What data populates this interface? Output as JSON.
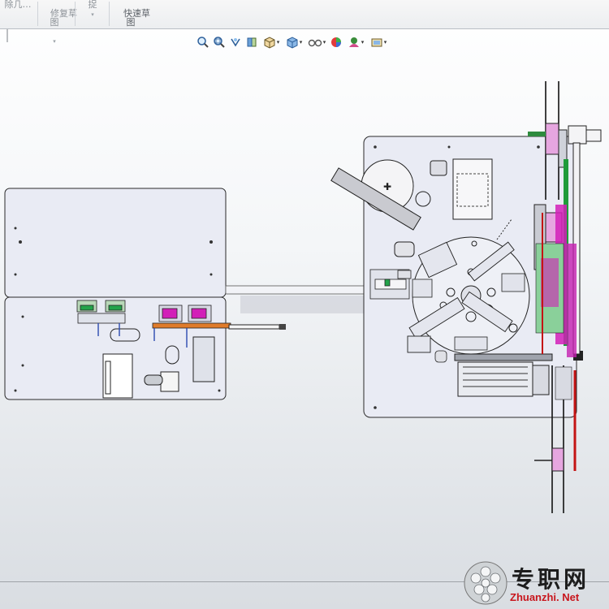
{
  "ribbon": {
    "items": [
      {
        "label": "除几…"
      },
      {
        "label": "修复草\n图"
      },
      {
        "label": "捉"
      },
      {
        "label": "快速草\n图"
      }
    ]
  },
  "hud_toolbar": {
    "tools": [
      {
        "icon": "zoom-to-fit-icon"
      },
      {
        "icon": "zoom-to-area-icon"
      },
      {
        "icon": "previous-view-icon"
      },
      {
        "icon": "section-view-icon"
      },
      {
        "icon": "view-orientation-icon"
      },
      {
        "icon": "display-style-icon"
      },
      {
        "icon": "hide-show-items-icon"
      },
      {
        "icon": "edit-appearance-icon"
      },
      {
        "icon": "apply-scene-icon"
      },
      {
        "icon": "view-settings-icon"
      }
    ]
  },
  "watermark": {
    "cn": "专职网",
    "en": "Zhuanzhi. Net"
  },
  "colors": {
    "plate_fill": "#e9ebf4",
    "plate_stroke": "#2a2a2a",
    "magenta": "#d21fb8",
    "green": "#1f9b3a",
    "red": "#c41414",
    "orange": "#e07b2a"
  }
}
